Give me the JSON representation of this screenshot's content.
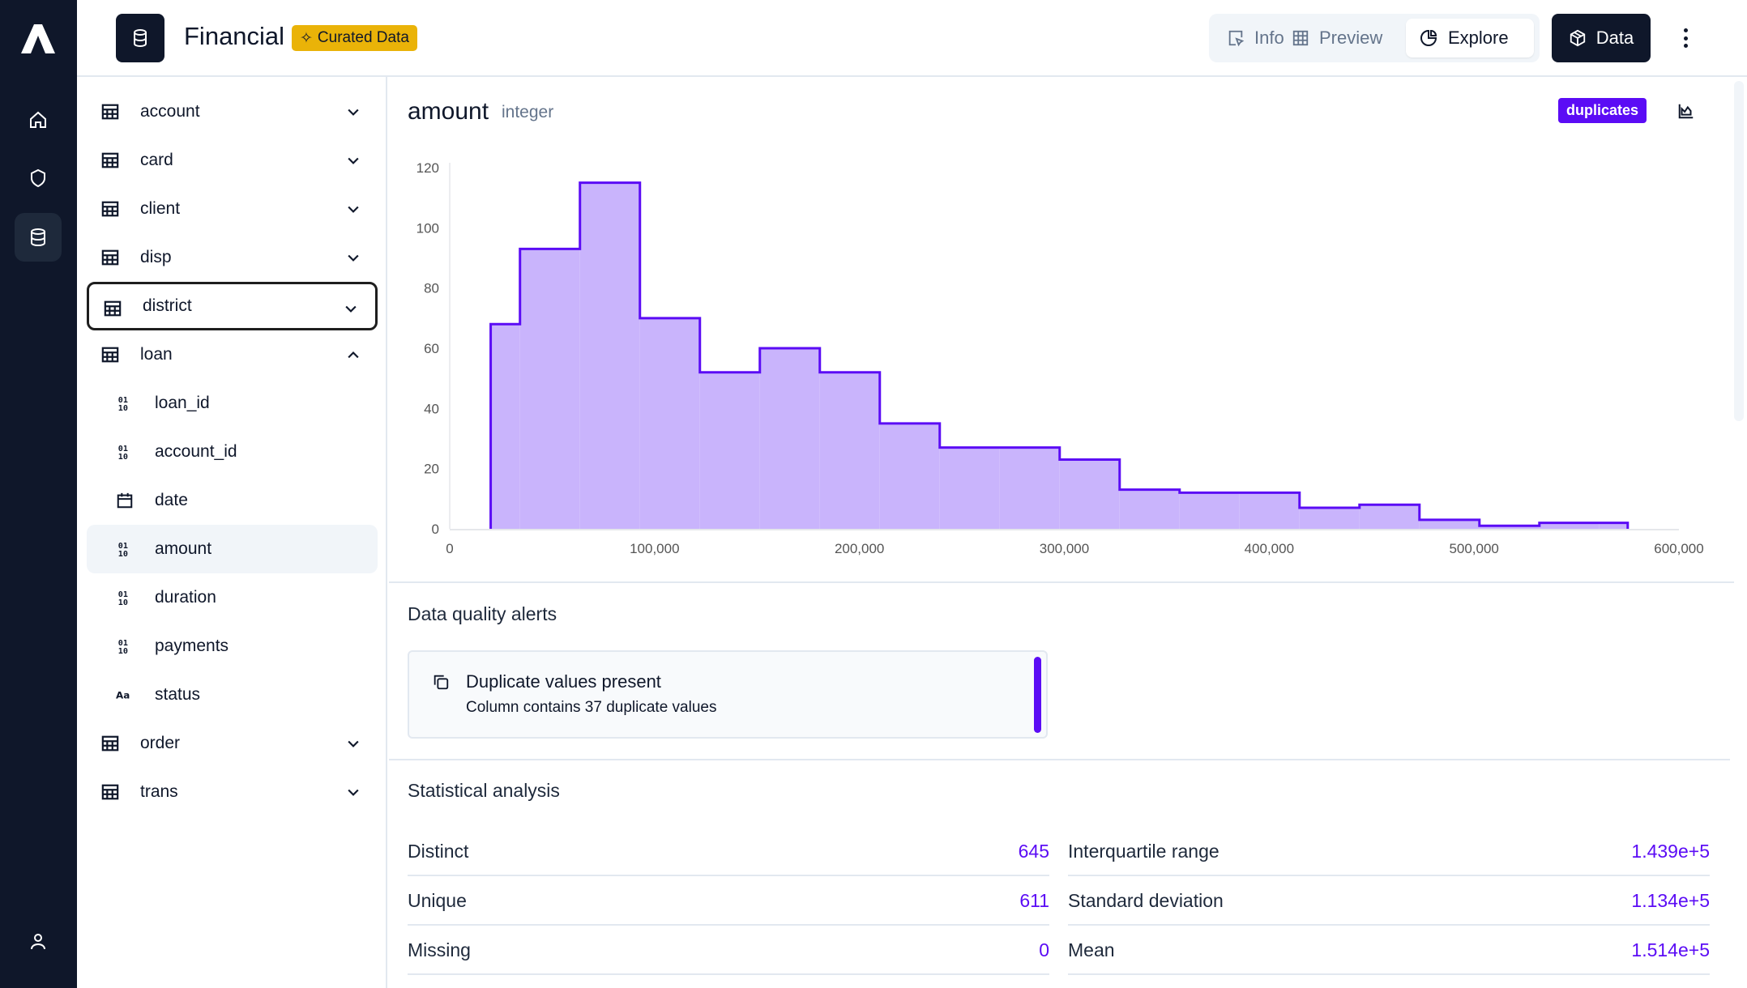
{
  "header": {
    "title": "Financial",
    "badge": "Curated Data",
    "tabs": [
      {
        "label": "Info",
        "icon": "cursor-icon"
      },
      {
        "label": "Preview",
        "icon": "grid-icon"
      },
      {
        "label": "Explore",
        "icon": "pie-chart-icon",
        "active": true
      }
    ],
    "data_button": "Data"
  },
  "sidebar": {
    "items": [
      {
        "label": "account",
        "type": "table"
      },
      {
        "label": "card",
        "type": "table"
      },
      {
        "label": "client",
        "type": "table"
      },
      {
        "label": "disp",
        "type": "table"
      },
      {
        "label": "district",
        "type": "table",
        "focused": true
      },
      {
        "label": "loan",
        "type": "table",
        "expanded": true
      },
      {
        "label": "loan_id",
        "type": "numeric"
      },
      {
        "label": "account_id",
        "type": "numeric"
      },
      {
        "label": "date",
        "type": "date"
      },
      {
        "label": "amount",
        "type": "numeric",
        "selected": true
      },
      {
        "label": "duration",
        "type": "numeric"
      },
      {
        "label": "payments",
        "type": "numeric"
      },
      {
        "label": "status",
        "type": "text"
      },
      {
        "label": "order",
        "type": "table"
      },
      {
        "label": "trans",
        "type": "table"
      }
    ]
  },
  "column": {
    "name": "amount",
    "type": "integer",
    "badge": "duplicates"
  },
  "alerts": {
    "title": "Data quality alerts",
    "items": [
      {
        "title": "Duplicate values present",
        "description": "Column contains 37 duplicate values"
      }
    ]
  },
  "stats": {
    "title": "Statistical analysis",
    "left": [
      {
        "label": "Distinct",
        "value": "645"
      },
      {
        "label": "Unique",
        "value": "611"
      },
      {
        "label": "Missing",
        "value": "0"
      }
    ],
    "right": [
      {
        "label": "Interquartile range",
        "value": "1.439e+5"
      },
      {
        "label": "Standard deviation",
        "value": "1.134e+5"
      },
      {
        "label": "Mean",
        "value": "1.514e+5"
      }
    ]
  },
  "colors": {
    "accent": "#5b0cf5",
    "fill": "#c9b4fc",
    "dark": "#0f172a",
    "badge": "#eab308"
  },
  "chart_data": {
    "type": "area",
    "subtype": "histogram-step",
    "edges": [
      20000,
      34300,
      63570,
      92840,
      122110,
      151380,
      180650,
      209920,
      239190,
      268460,
      297730,
      327000,
      356270,
      385540,
      414810,
      444080,
      473350,
      502620,
      531890,
      561160,
      575000
    ],
    "counts": [
      68,
      93,
      115,
      70,
      52,
      60,
      52,
      35,
      27,
      27,
      23,
      13,
      12,
      12,
      7,
      8,
      3,
      1,
      2,
      2
    ],
    "xlim": [
      0,
      600000
    ],
    "ylim": [
      0,
      120
    ],
    "xticks": [
      "0",
      "100,000",
      "200,000",
      "300,000",
      "400,000",
      "500,000",
      "600,000"
    ],
    "yticks": [
      "0",
      "20",
      "40",
      "60",
      "80",
      "100",
      "120"
    ],
    "xlabel": "",
    "ylabel": "",
    "title": "",
    "grid": false
  }
}
